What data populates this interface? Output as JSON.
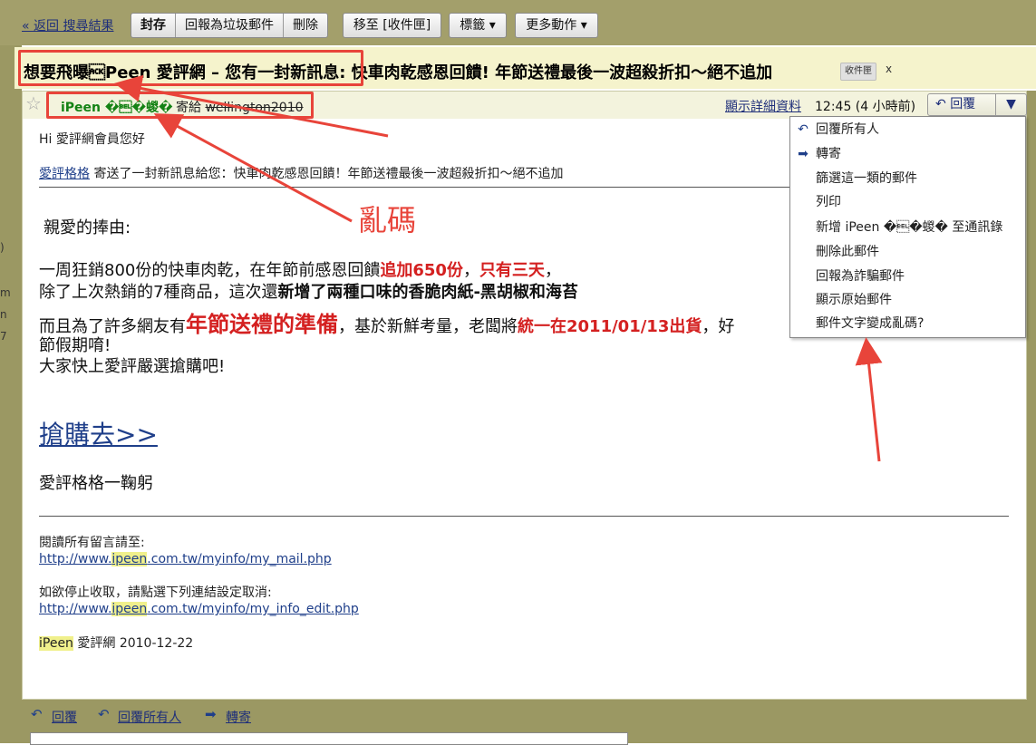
{
  "toolbar": {
    "back_link": "« 返回 搜尋結果",
    "archive": "封存",
    "report_spam": "回報為垃圾郵件",
    "delete": "刪除",
    "move_to": "移至 [收件匣]",
    "labels": "標籤 ▾",
    "more_actions": "更多動作 ▾"
  },
  "subject": {
    "text": "想要飛曝\u0006Peen 愛評網 – 您有一封新訊息:  快車肉乾感恩回饋!  年節送禮最後一波超殺折扣～絕不追加",
    "label": "收件匣",
    "label_close": "x"
  },
  "header": {
    "sender": "iPeen �\u0007�蝬�",
    "to_prefix": "寄給",
    "to_name": "wellington2010",
    "show_details": "顯示詳細資料",
    "time": "12:45 (4 小時前)",
    "reply": "回覆",
    "reply_menu_arrow": "▼"
  },
  "body": {
    "greeting": "Hi 愛評網會員您好",
    "notice_link": "愛評格格",
    "notice_text": " 寄送了一封新訊息給您：快車肉乾感恩回饋！年節送禮最後一波超殺折扣～絕不追加",
    "salutation": "親愛的捧由:",
    "line1_a": "一周狂銷800份的快車肉乾，在年節前感恩回饋",
    "line1_b": "追加650份",
    "line1_c": "，",
    "line1_d": "只有三天",
    "line1_e": "，",
    "line2_a": "除了上次熱銷的7種商品，這次還",
    "line2_b": "新增了兩種口味的香脆肉紙-黑胡椒和海苔",
    "line3_a": "而且為了許多網友有",
    "line3_b": "年節送禮的準備",
    "line3_c": "，基於新鮮考量，老闆將",
    "line3_d": "統一在2011/01/13出貨",
    "line3_e": "，好",
    "line4": "節假期唷!",
    "line5": "大家快上愛評嚴選搶購吧!",
    "cta": "搶購去>>",
    "signature": "愛評格格一鞠躬",
    "read_all_label": "閱讀所有留言請至:",
    "read_all_url_a": "http://www.",
    "read_all_url_hl": "ipeen",
    "read_all_url_b": ".com.tw/myinfo/my_mail.php",
    "unsubscribe_label": "如欲停止收取，請點選下列連結設定取消:",
    "unsub_url_a": "http://www.",
    "unsub_url_hl": "ipeen",
    "unsub_url_b": ".com.tw/myinfo/my_info_edit.php",
    "footer_hl": "iPeen",
    "footer_text": " 愛評網 2010-12-22"
  },
  "menu": {
    "reply_all": "回覆所有人",
    "forward": "轉寄",
    "filter": "篩選這一類的郵件",
    "print": "列印",
    "add_contact": "新增 iPeen �\u0007�蝬� 至通訊錄",
    "delete_msg": "刪除此郵件",
    "report_phishing": "回報為詐騙郵件",
    "show_original": "顯示原始郵件",
    "garbled": "郵件文字變成亂碼?"
  },
  "footer": {
    "reply": "回覆",
    "reply_all": "回覆所有人",
    "forward": "轉寄"
  },
  "annotation": {
    "label": "亂碼"
  },
  "edge_fragments": [
    ")",
    "m",
    "n",
    "7"
  ],
  "icons": {
    "star": "star-icon",
    "reply": "reply-icon",
    "reply_all": "reply-all-icon",
    "forward": "forward-icon"
  },
  "colors": {
    "toolbar_bg": "#a39f6b",
    "subject_band": "#f5f3cc",
    "sender_green": "#148214",
    "link_blue": "#1f2f7a",
    "emphasis_red": "#d42020",
    "annotation_red": "#e8443a",
    "highlight_yellow": "#f0f08c"
  }
}
